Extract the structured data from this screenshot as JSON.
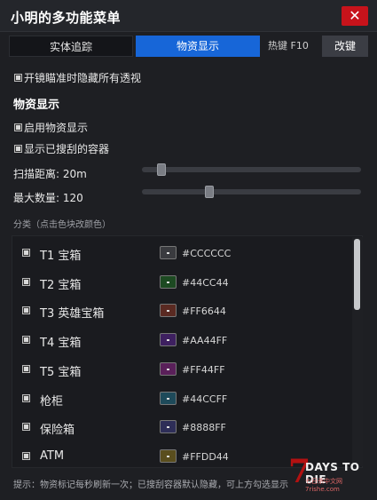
{
  "window": {
    "title": "小明的多功能菜单",
    "close_label": "✕"
  },
  "tabs": {
    "tracking": "实体追踪",
    "items": "物资显示",
    "hotkey": "热键 F10",
    "change_key": "改键"
  },
  "options": {
    "hide_on_scope": "开镜瞄准时隐藏所有透视",
    "section_title": "物资显示",
    "enable_items": "启用物资显示",
    "show_searched": "显示已搜刮的容器"
  },
  "sliders": {
    "scan_distance": {
      "label": "扫描距离: 20m",
      "value": 20,
      "fraction": 0.07
    },
    "max_count": {
      "label": "最大数量: 120",
      "value": 120,
      "fraction": 0.3
    }
  },
  "category_title": "分类（点击色块改颜色）",
  "categories": [
    {
      "name": "T1 宝箱",
      "hex": "#CCCCCC",
      "color": "#3a3b3f"
    },
    {
      "name": "T2 宝箱",
      "hex": "#44CC44",
      "color": "#1d4a22"
    },
    {
      "name": "T3 英雄宝箱",
      "hex": "#FF6644",
      "color": "#5a2a22"
    },
    {
      "name": "T4 宝箱",
      "hex": "#AA44FF",
      "color": "#3e2060"
    },
    {
      "name": "T5 宝箱",
      "hex": "#FF44FF",
      "color": "#5a205a"
    },
    {
      "name": "枪柜",
      "hex": "#44CCFF",
      "color": "#1e4a5a"
    },
    {
      "name": "保险箱",
      "hex": "#8888FF",
      "color": "#2e2e58"
    },
    {
      "name": "ATM",
      "hex": "#FFDD44",
      "color": "#5a4e1e"
    }
  ],
  "hint": "提示：物资标记每秒刷新一次；已搜刮容器默认隐藏，可上方勾选显示",
  "watermark": {
    "main": "DAYS TO DIE",
    "digit": "7",
    "sub": "七日杀中文网 7rishe.com"
  }
}
